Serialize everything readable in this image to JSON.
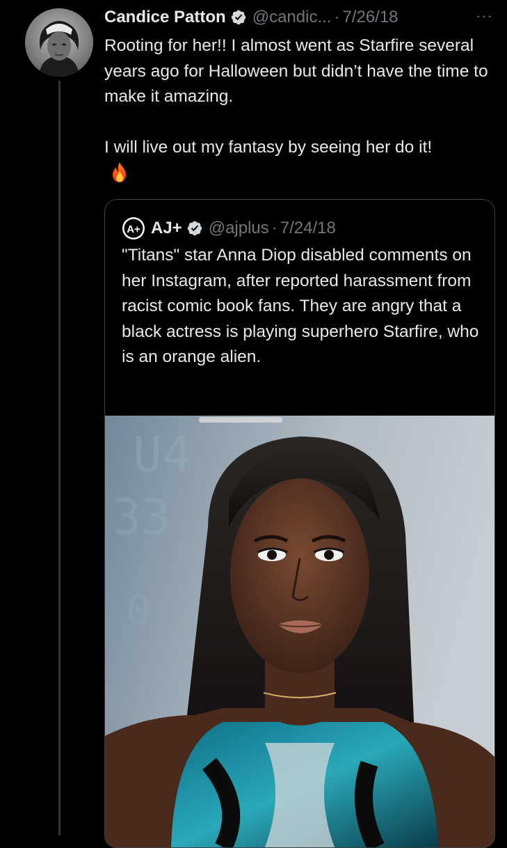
{
  "tweet": {
    "author_name": "Candice Patton",
    "handle": "@candic...",
    "separator": "·",
    "date": "7/26/18",
    "more_icon": "···",
    "text_line1": "Rooting for her!! I almost went as Starfire several years ago for Halloween but didn’t have the time to make it amazing.",
    "text_line2": "I will live out my fantasy by seeing her do it!",
    "emoji": "fire-emoji"
  },
  "quoted_tweet": {
    "author_name": "AJ+",
    "handle": "@ajplus",
    "separator": "·",
    "date": "7/24/18",
    "text": "\"Titans\" star Anna Diop disabled comments on her Instagram, after reported harassment from racist comic book fans. They are angry that a black actress is playing superhero Starfire, who is an orange alien.",
    "logo_text": "A+"
  },
  "colors": {
    "background": "#000000",
    "text": "#e7e9ea",
    "muted": "#71767b",
    "verified": "#d6d9db",
    "border": "#3a3e41"
  }
}
